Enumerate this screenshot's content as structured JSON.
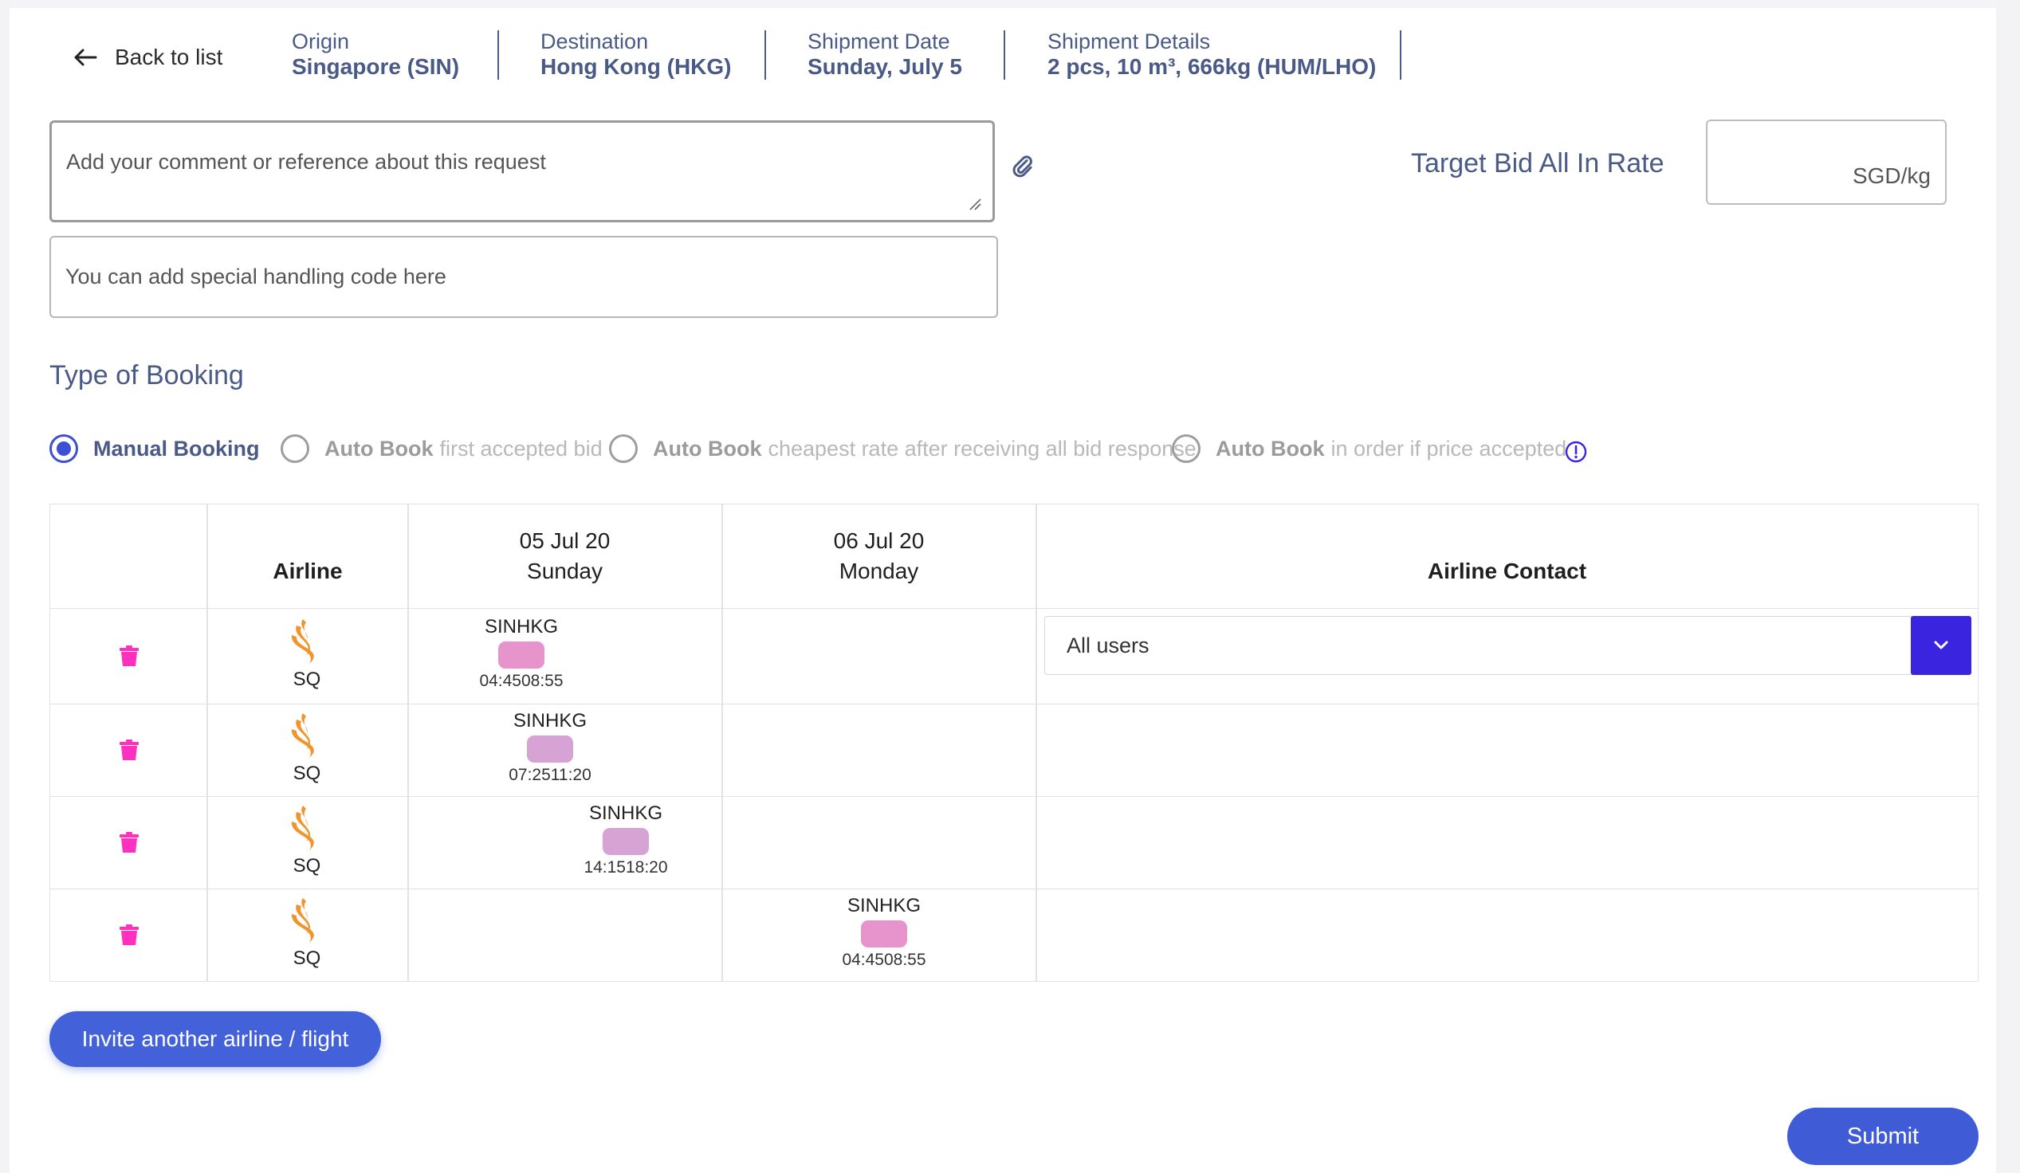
{
  "header": {
    "back_label": "Back to list",
    "origin": {
      "label": "Origin",
      "value": "Singapore (SIN)"
    },
    "destination": {
      "label": "Destination",
      "value": "Hong Kong (HKG)"
    },
    "shipment_date": {
      "label": "Shipment Date",
      "value": "Sunday, July 5"
    },
    "shipment_details": {
      "label": "Shipment Details",
      "value": "2 pcs, 10 m³, 666kg (HUM/LHO)"
    }
  },
  "form": {
    "comment_placeholder": "Add your comment or reference about this request",
    "shc_placeholder": "You can add special handling code here",
    "target_label": "Target Bid All In Rate",
    "target_unit": "SGD/kg"
  },
  "booking": {
    "title": "Type of Booking",
    "options": [
      {
        "strong": "Manual Booking",
        "soft": "",
        "selected": true
      },
      {
        "strong": "Auto Book",
        "soft": "first accepted bid",
        "selected": false
      },
      {
        "strong": "Auto Book",
        "soft": "cheapest rate after receiving all bid response",
        "selected": false
      },
      {
        "strong": "Auto Book",
        "soft": "in order if price accepted",
        "selected": false
      }
    ]
  },
  "table": {
    "col_airline": "Airline",
    "col_day1_date": "05 Jul 20",
    "col_day1_day": "Sunday",
    "col_day2_date": "06 Jul 20",
    "col_day2_day": "Monday",
    "col_contact": "Airline Contact",
    "contact_value": "All users",
    "rows": [
      {
        "airline": "SQ",
        "route": "SINHKG",
        "time": "04:4508:55",
        "pill_color": "#e793cc"
      },
      {
        "airline": "SQ",
        "route": "SINHKG",
        "time": "07:2511:20",
        "pill_color": "#d7a2d4"
      },
      {
        "airline": "SQ",
        "route": "SINHKG",
        "time": "14:1518:20",
        "pill_color": "#d7a2d4"
      },
      {
        "airline": "SQ",
        "route": "SINHKG",
        "time": "04:4508:55",
        "pill_color": "#e793cc"
      }
    ]
  },
  "colors": {
    "accent": "#3f5bd6",
    "trash": "#ff2fc0",
    "logo": "#f0952b"
  },
  "buttons": {
    "invite": "Invite another airline / flight",
    "submit": "Submit"
  }
}
